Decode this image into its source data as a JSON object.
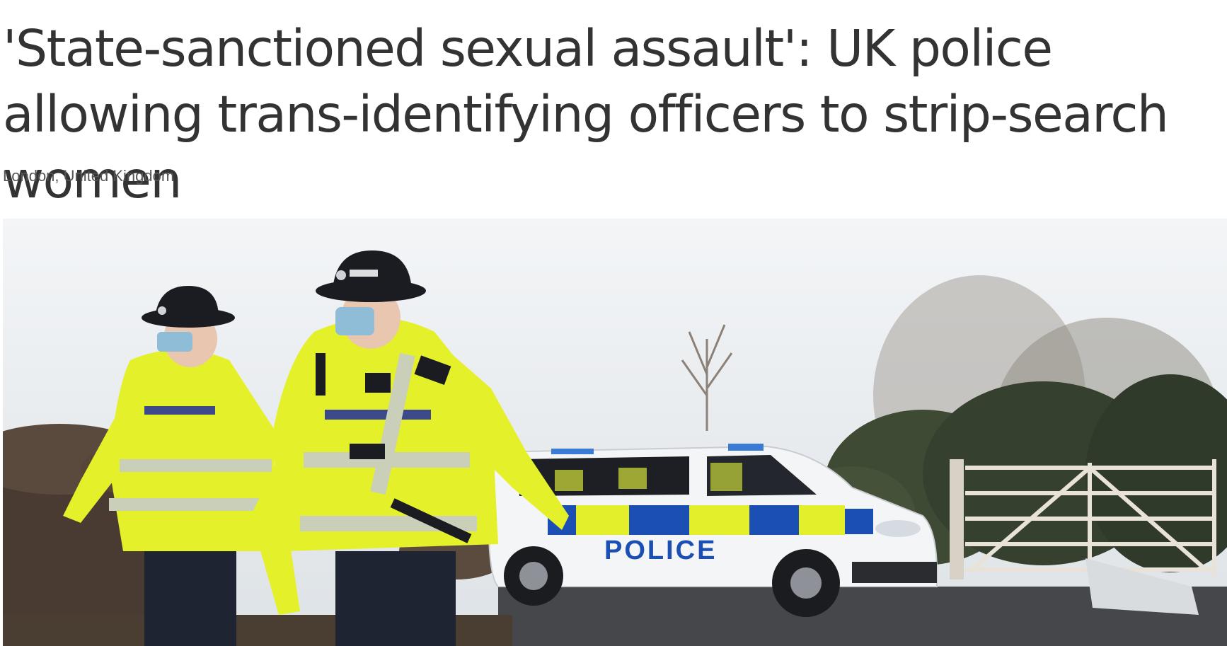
{
  "article": {
    "headline": "'State-sanctioned sexual assault': UK police allowing trans-identifying officers to strip-search women",
    "location": "London, United Kingdom"
  },
  "photo": {
    "vehicle_lettering": "POLICE",
    "colors": {
      "hi_vis_yellow": "#e4f02a",
      "navy": "#1f2433",
      "police_blue": "#1c4fb3",
      "sky": "#eef1f4"
    }
  }
}
